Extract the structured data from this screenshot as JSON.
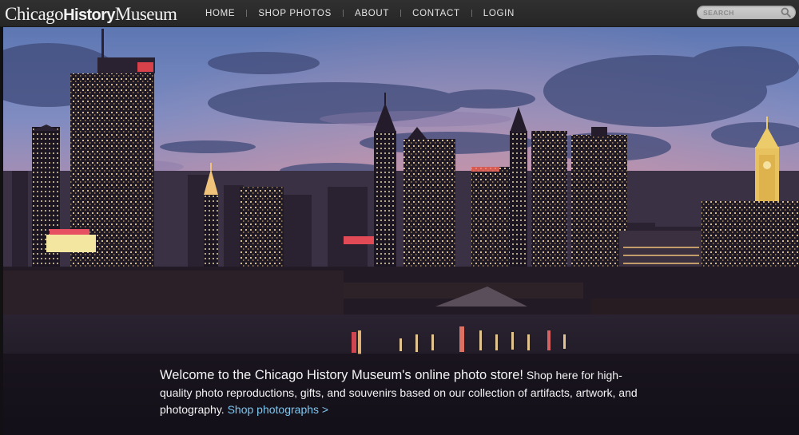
{
  "brand": {
    "word1": "Chicago",
    "word2": "History",
    "word3": "Museum"
  },
  "nav": {
    "items": [
      {
        "label": "HOME"
      },
      {
        "label": "SHOP PHOTOS"
      },
      {
        "label": "ABOUT"
      },
      {
        "label": "CONTACT"
      },
      {
        "label": "LOGIN"
      }
    ]
  },
  "search": {
    "placeholder": "SEARCH",
    "icon": "search-icon"
  },
  "hero": {
    "icon": "chicago-skyline-photo"
  },
  "welcome": {
    "lead": "Welcome to the Chicago History Museum's online photo store!",
    "body": " Shop here for high-quality photo reproductions, gifts, and souvenirs based on our collection of artifacts, artwork, and photography. ",
    "link": "Shop photographs >"
  },
  "colors": {
    "link": "#7fc6ef",
    "bar": "#2b2b29"
  }
}
